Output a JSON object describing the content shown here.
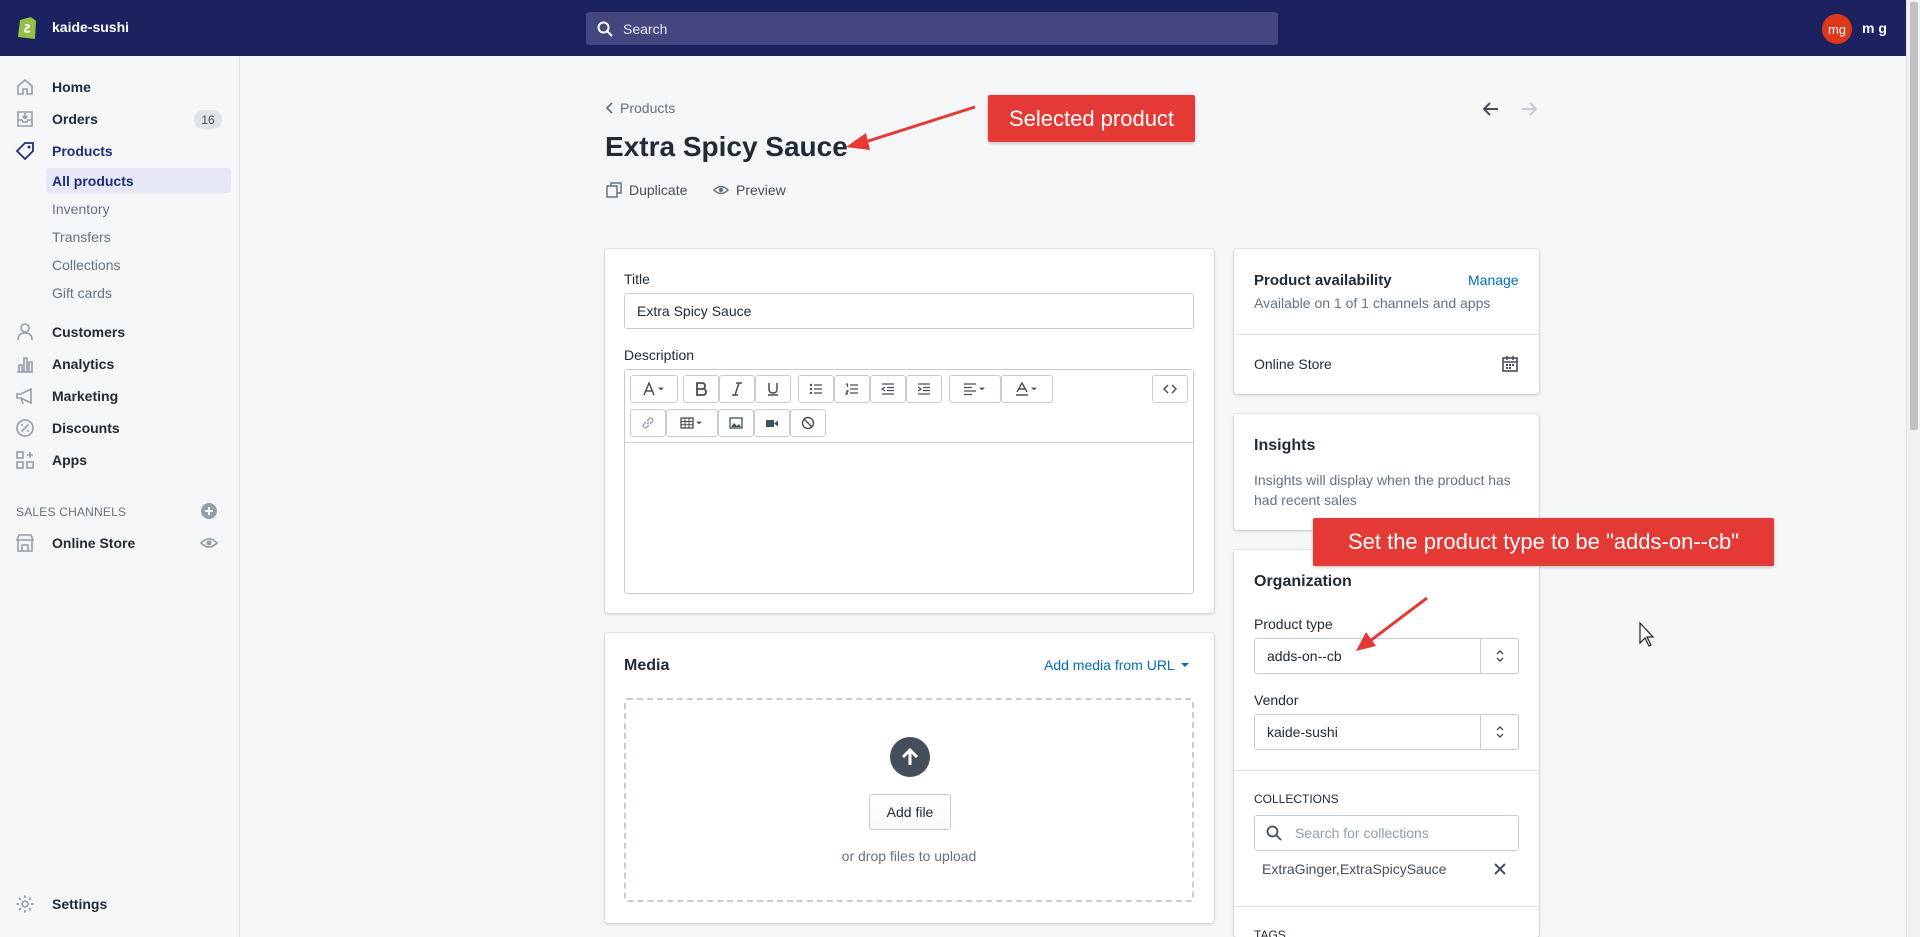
{
  "topbar": {
    "store_name": "kaide-sushi",
    "search_placeholder": "Search",
    "avatar_initials": "mg",
    "user_name": "m g"
  },
  "sidebar": {
    "items": [
      {
        "label": "Home",
        "icon": "home-icon"
      },
      {
        "label": "Orders",
        "icon": "orders-icon",
        "badge": "16"
      },
      {
        "label": "Products",
        "icon": "tag-icon"
      },
      {
        "label": "Customers",
        "icon": "person-icon"
      },
      {
        "label": "Analytics",
        "icon": "bar-chart-icon"
      },
      {
        "label": "Marketing",
        "icon": "megaphone-icon"
      },
      {
        "label": "Discounts",
        "icon": "discount-icon"
      },
      {
        "label": "Apps",
        "icon": "apps-icon"
      }
    ],
    "product_subitems": [
      "All products",
      "Inventory",
      "Transfers",
      "Collections",
      "Gift cards"
    ],
    "sales_channels_heading": "SALES CHANNELS",
    "online_store": "Online Store",
    "settings": "Settings"
  },
  "page": {
    "breadcrumb": "Products",
    "title": "Extra Spicy Sauce",
    "duplicate": "Duplicate",
    "preview": "Preview"
  },
  "product_form": {
    "title_label": "Title",
    "title_value": "Extra Spicy Sauce",
    "description_label": "Description",
    "media_title": "Media",
    "add_media_url": "Add media from URL",
    "add_file": "Add file",
    "drop_text": "or drop files to upload"
  },
  "availability": {
    "title": "Product availability",
    "manage": "Manage",
    "subtitle": "Available on 1 of 1 channels and apps",
    "channel": "Online Store"
  },
  "insights": {
    "title": "Insights",
    "text": "Insights will display when the product has had recent sales"
  },
  "organization": {
    "title": "Organization",
    "product_type_label": "Product type",
    "product_type_value": "adds-on--cb",
    "vendor_label": "Vendor",
    "vendor_value": "kaide-sushi",
    "collections_heading": "COLLECTIONS",
    "collections_placeholder": "Search for collections",
    "collection_tag": "ExtraGinger,ExtraSpicySauce",
    "tags_heading": "TAGS"
  },
  "annotations": {
    "callout_1": "Selected product",
    "callout_2": "Set the product type to be \"adds-on--cb\""
  },
  "colors": {
    "topbar": "#1c2260",
    "callout": "#e53935",
    "link": "#006fbb",
    "avatar": "#de3618"
  }
}
